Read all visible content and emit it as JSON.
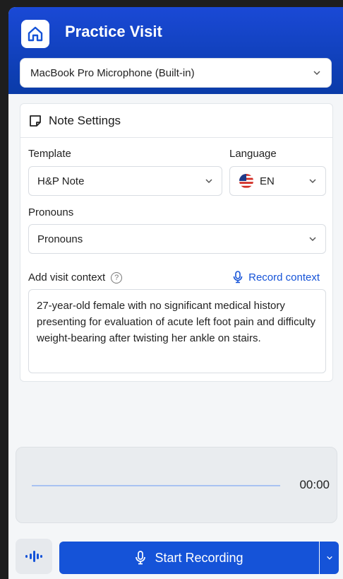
{
  "header": {
    "title": "Practice Visit"
  },
  "microphone": {
    "selected": "MacBook Pro Microphone (Built-in)"
  },
  "note_settings": {
    "title": "Note Settings",
    "template_label": "Template",
    "template_value": "H&P Note",
    "language_label": "Language",
    "language_value": "EN",
    "pronouns_label": "Pronouns",
    "pronouns_value": "Pronouns",
    "context_label": "Add visit context",
    "record_context_label": "Record context",
    "context_text": "27-year-old female with no significant medical history presenting for evaluation of acute left foot pain and difficulty weight-bearing after twisting her ankle on stairs."
  },
  "recorder": {
    "timer": "00:00",
    "start_label": "Start Recording"
  },
  "colors": {
    "primary": "#1553d8",
    "header": "#0d3fb5"
  }
}
